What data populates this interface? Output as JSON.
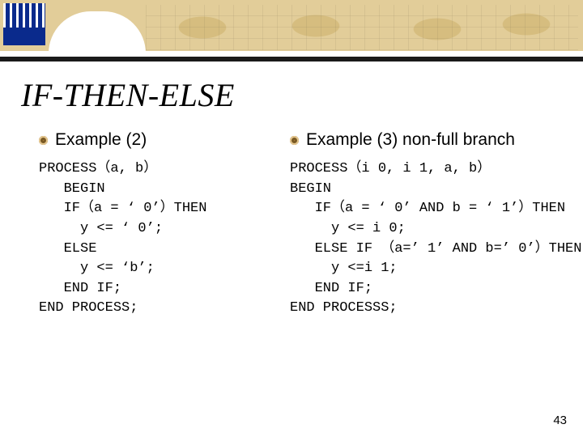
{
  "slide": {
    "title": "IF-THEN-ELSE",
    "page_number": "43"
  },
  "left": {
    "heading": "Example (2)",
    "code": "PROCESS（a, b）\n   BEGIN\n   IF（a = ‘ 0’）THEN\n     y <= ‘ 0’;\n   ELSE\n     y <= ‘b’;\n   END IF;\nEND PROCESS;"
  },
  "right": {
    "heading": "Example (3) non-full branch",
    "code": "PROCESS（i 0, i 1, a, b）\nBEGIN\n   IF（a = ‘ 0’ AND b = ‘ 1’）THEN\n     y <= i 0;\n   ELSE IF （a=’ 1’ AND b=’ 0’）THEN\n     y <=i 1;\n   END IF;\nEND PROCESSS;"
  }
}
